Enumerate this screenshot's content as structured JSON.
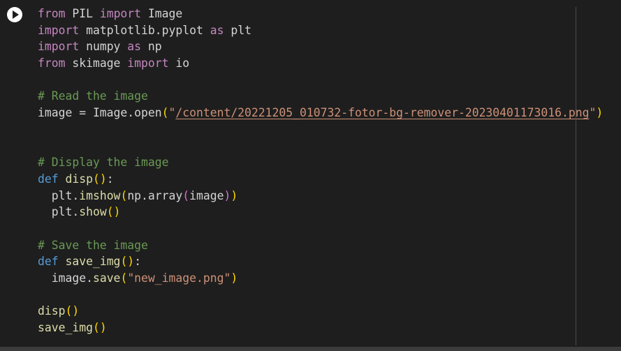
{
  "cell": {
    "run_button_icon": "play-icon",
    "lines": [
      [
        "from",
        " PIL ",
        "import",
        " Image"
      ],
      [
        "import",
        " matplotlib.pyplot ",
        "as",
        " plt"
      ],
      [
        "import",
        " numpy ",
        "as",
        " np"
      ],
      [
        "from",
        " skimage ",
        "import",
        " io"
      ],
      [],
      [
        "# Read the image"
      ],
      [
        "image = Image.open",
        "(",
        "\"",
        "/content/20221205_010732-fotor-bg-remover-20230401173016.png",
        "\"",
        ")"
      ],
      [],
      [],
      [
        "# Display the image"
      ],
      [
        "def",
        " ",
        "disp",
        "()",
        ":"
      ],
      [
        "  plt.",
        "imshow",
        "(",
        "np.array",
        "(",
        "image",
        ")",
        ")"
      ],
      [
        "  plt.",
        "show",
        "()"
      ],
      [],
      [
        "# Save the image"
      ],
      [
        "def",
        " ",
        "save_img",
        "()",
        ":"
      ],
      [
        "  image.",
        "save",
        "(",
        "\"new_image.png\"",
        ")"
      ],
      [],
      [
        "disp",
        "()"
      ],
      [
        "save_img",
        "()"
      ]
    ]
  }
}
